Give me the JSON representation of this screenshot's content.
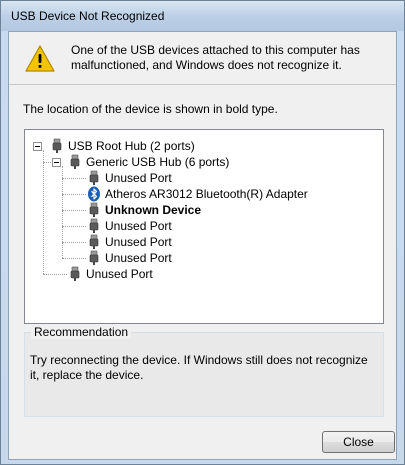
{
  "window": {
    "title": "USB Device Not Recognized"
  },
  "message": "One of the USB devices attached to this computer has malfunctioned, and Windows does not recognize it.",
  "location_text": "The location of the device is shown in bold type.",
  "tree": {
    "root": {
      "label": "USB Root Hub (2 ports)",
      "icon": "usb-plug-icon"
    },
    "hub": {
      "label": "Generic USB Hub (6 ports)",
      "icon": "usb-plug-icon"
    },
    "hub_children": [
      {
        "label": "Unused Port",
        "icon": "usb-plug-icon",
        "bold": false
      },
      {
        "label": "Atheros AR3012 Bluetooth(R) Adapter",
        "icon": "bluetooth-icon",
        "bold": false
      },
      {
        "label": "Unknown Device",
        "icon": "usb-plug-icon",
        "bold": true
      },
      {
        "label": "Unused Port",
        "icon": "usb-plug-icon",
        "bold": false
      },
      {
        "label": "Unused Port",
        "icon": "usb-plug-icon",
        "bold": false
      },
      {
        "label": "Unused Port",
        "icon": "usb-plug-icon",
        "bold": false
      }
    ],
    "root_last": {
      "label": "Unused Port",
      "icon": "usb-plug-icon"
    }
  },
  "recommendation": {
    "title": "Recommendation",
    "text": "Try reconnecting the device. If Windows still does not recognize it, replace the device."
  },
  "buttons": {
    "close_label": "Close"
  },
  "colors": {
    "warning_yellow": "#f5c400",
    "bluetooth_blue": "#1a5fb4",
    "title_bar": "#bcd0e6"
  }
}
